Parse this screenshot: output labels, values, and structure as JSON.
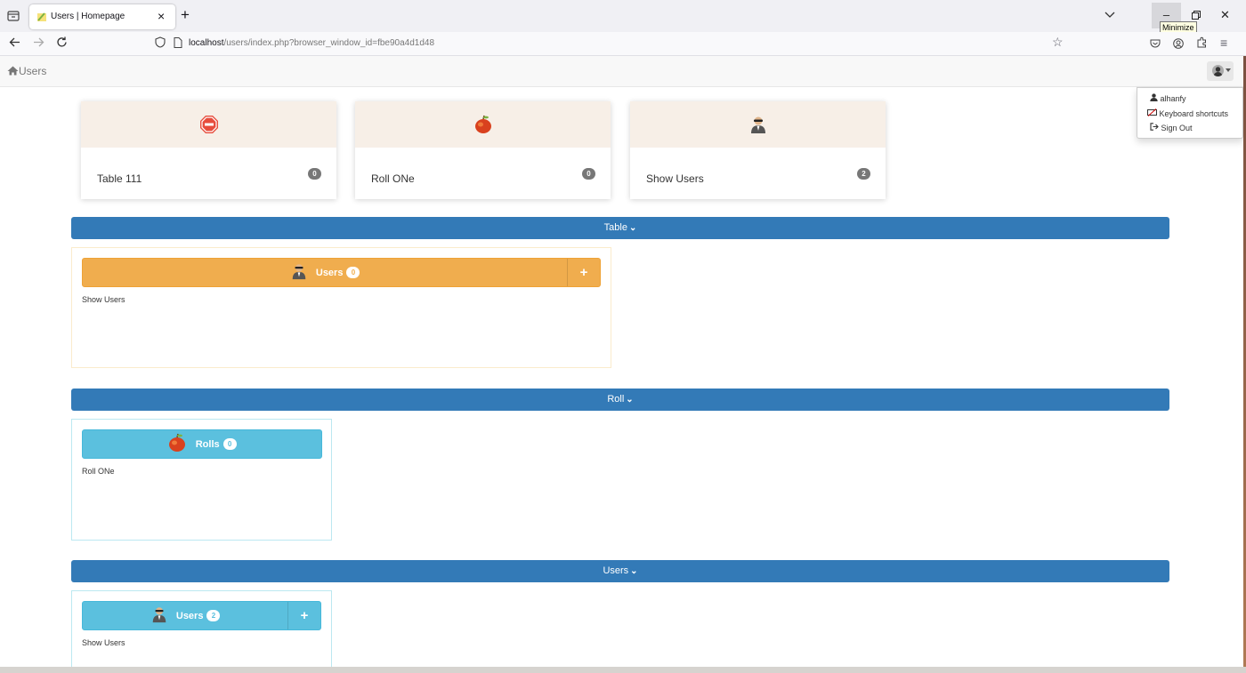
{
  "browser": {
    "tab_title": "Users | Homepage",
    "url_host": "localhost",
    "url_path": "/users/index.php?browser_window_id=fbe90a4d1d48",
    "tooltip": "Minimize"
  },
  "app": {
    "brand": "Users",
    "user_menu": {
      "username": "alhanfy",
      "shortcuts": "Keyboard shortcuts",
      "signout": "Sign Out"
    }
  },
  "cards": [
    {
      "label": "Table 111",
      "count": "0",
      "icon": "stop-sign-icon"
    },
    {
      "label": "Roll ONe",
      "count": "0",
      "icon": "apple-icon"
    },
    {
      "label": "Show Users",
      "count": "2",
      "icon": "spy-user-icon"
    }
  ],
  "sections": [
    {
      "title": "Table",
      "button": {
        "label": "Users",
        "count": "0"
      },
      "text": "Show Users",
      "color": "#f0ad4e"
    },
    {
      "title": "Roll",
      "button": {
        "label": "Rolls",
        "count": "0"
      },
      "text": "Roll ONe",
      "color": "#5bc0de"
    },
    {
      "title": "Users",
      "button": {
        "label": "Users",
        "count": "2"
      },
      "text": "Show Users",
      "color": "#5bc0de"
    }
  ],
  "colors": {
    "primary": "#337ab7",
    "warning": "#f0ad4e",
    "info": "#5bc0de"
  }
}
